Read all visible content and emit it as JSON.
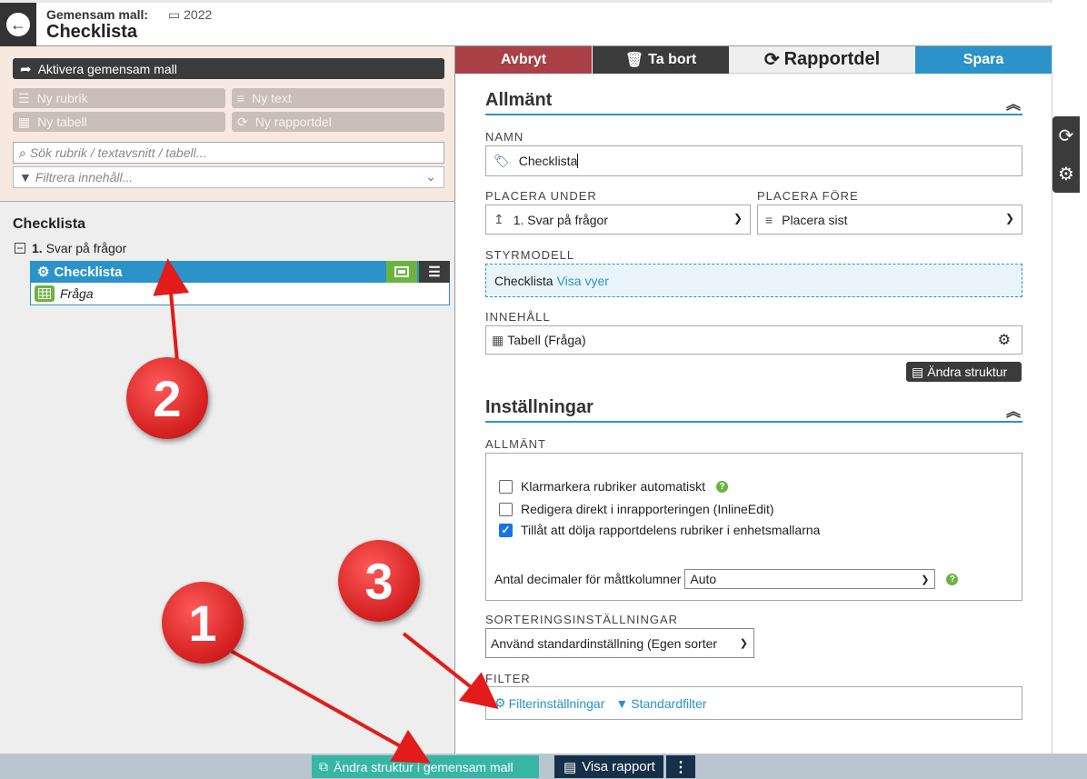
{
  "header": {
    "subtitle": "Gemensam mall:",
    "year": "2022",
    "title": "Checklista"
  },
  "toolbar": {
    "activate_label": "Aktivera gemensam mall",
    "new_heading": "Ny rubrik",
    "new_text": "Ny text",
    "new_table": "Ny tabell",
    "new_report_part": "Ny rapportdel",
    "search_placeholder": "Sök rubrik / textavsnitt / tabell...",
    "filter_placeholder": "Filtrera innehåll..."
  },
  "tree": {
    "title": "Checklista",
    "level1_number": "1.",
    "level1_label": "Svar på frågor",
    "selected_label": "Checklista",
    "child_label": "Fråga"
  },
  "actions": {
    "cancel": "Avbryt",
    "delete": "Ta bort",
    "report_part": "Rapportdel",
    "save": "Spara"
  },
  "general": {
    "heading": "Allmänt",
    "name_label": "NAMN",
    "name_value": "Checklista",
    "place_under_label": "PLACERA UNDER",
    "place_under_value": "1. Svar på frågor",
    "place_before_label": "PLACERA FÖRE",
    "place_before_value": "Placera sist",
    "control_model_label": "STYRMODELL",
    "control_model_value": "Checklista",
    "control_model_link": "Visa vyer",
    "content_label": "INNEHÅLL",
    "content_value": "Tabell (Fråga)",
    "change_structure": "Ändra struktur"
  },
  "settings": {
    "heading": "Inställningar",
    "general_label": "ALLMÄNT",
    "checkbox_1": "Klarmarkera rubriker automatiskt",
    "checkbox_2": "Redigera direkt i inrapporteringen (InlineEdit)",
    "checkbox_3": "Tillåt att dölja rapportdelens rubriker i enhetsmallarna",
    "checkbox_states": [
      false,
      false,
      true
    ],
    "decimals_label": "Antal decimaler för måttkolumner",
    "decimals_value": "Auto",
    "sorting_label": "SORTERINGSINSTÄLLNINGAR",
    "sorting_value": "Använd standardinställning (Egen sorter",
    "filter_label": "FILTER",
    "filter_settings": "Filterinställningar",
    "standard_filter": "Standardfilter"
  },
  "bottom": {
    "change_structure_shared": "Ändra struktur i gemensam mall",
    "view_report": "Visa rapport",
    "more": "⋮"
  },
  "annotations": {
    "m1": "1",
    "m2": "2",
    "m3": "3"
  },
  "colors": {
    "accent": "#2b93c9",
    "cancel": "#a94046",
    "dark": "#3b3b3b",
    "green": "#6cb33f",
    "teal": "#37b5a5",
    "navy": "#16304a",
    "marker": "#d21e1e"
  }
}
